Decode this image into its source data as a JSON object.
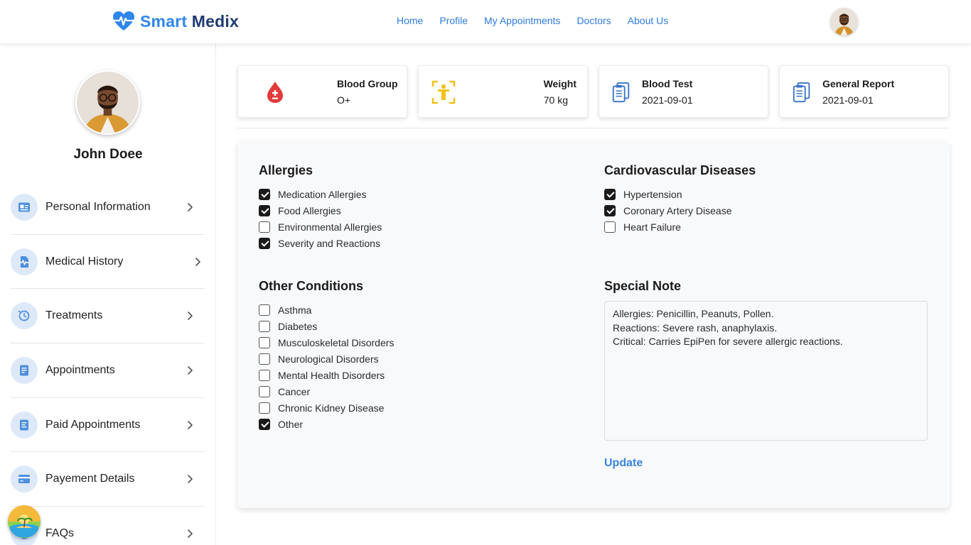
{
  "brand": {
    "name_part1": "Smart",
    "name_part2": "Medix",
    "color1": "#2f86eb",
    "color2": "#1f3a73"
  },
  "nav": {
    "items": [
      "Home",
      "Profile",
      "My Appointments",
      "Doctors",
      "About Us"
    ]
  },
  "user": {
    "name": "John Doee"
  },
  "sidebar": {
    "items": [
      {
        "label": "Personal Information",
        "icon": "id-card-icon"
      },
      {
        "label": "Medical History",
        "icon": "medical-file-icon"
      },
      {
        "label": "Treatments",
        "icon": "history-icon"
      },
      {
        "label": "Appointments",
        "icon": "document-icon"
      },
      {
        "label": "Paid Appointments",
        "icon": "receipt-icon"
      },
      {
        "label": "Payement Details",
        "icon": "credit-card-icon"
      },
      {
        "label": "FAQs",
        "icon": "question-icon"
      }
    ]
  },
  "stats": [
    {
      "title": "Blood Group",
      "value": "O+",
      "icon": "blood-drop-icon"
    },
    {
      "title": "Weight",
      "value": "70 kg",
      "icon": "weight-scale-icon"
    },
    {
      "title": "Blood Test",
      "value": "2021-09-01",
      "icon": "clipboard-icon"
    },
    {
      "title": "General Report",
      "value": "2021-09-01",
      "icon": "clipboard-icon"
    }
  ],
  "allergies": {
    "title": "Allergies",
    "items": [
      {
        "label": "Medication Allergies",
        "checked": true
      },
      {
        "label": "Food Allergies",
        "checked": true
      },
      {
        "label": "Environmental Allergies",
        "checked": false
      },
      {
        "label": "Severity and Reactions",
        "checked": true
      }
    ]
  },
  "cardio": {
    "title": "Cardiovascular Diseases",
    "items": [
      {
        "label": "Hypertension",
        "checked": true
      },
      {
        "label": "Coronary Artery Disease",
        "checked": true
      },
      {
        "label": "Heart Failure",
        "checked": false
      }
    ]
  },
  "other": {
    "title": "Other Conditions",
    "items": [
      {
        "label": "Asthma",
        "checked": false
      },
      {
        "label": "Diabetes",
        "checked": false
      },
      {
        "label": "Musculoskeletal Disorders",
        "checked": false
      },
      {
        "label": "Neurological Disorders",
        "checked": false
      },
      {
        "label": "Mental Health Disorders",
        "checked": false
      },
      {
        "label": "Cancer",
        "checked": false
      },
      {
        "label": "Chronic Kidney Disease",
        "checked": false
      },
      {
        "label": "Other",
        "checked": true
      }
    ]
  },
  "note": {
    "title": "Special Note",
    "text": "Allergies: Penicillin, Peanuts, Pollen.\nReactions: Severe rash, anaphylaxis.\nCritical: Carries EpiPen for severe allergic reactions."
  },
  "actions": {
    "update_label": "Update"
  },
  "colors": {
    "accent": "#2e7be0",
    "blood": "#e23b3b",
    "weight": "#f2c21b",
    "icon_bg": "#dde9f8"
  }
}
